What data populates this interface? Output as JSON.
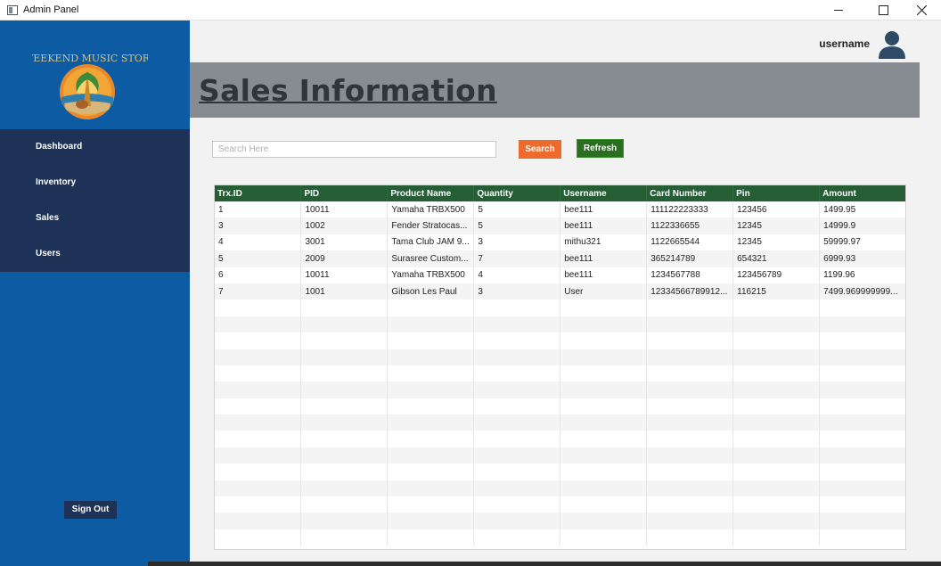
{
  "window": {
    "title": "Admin Panel"
  },
  "sidebar": {
    "logo_text": "WEEKEND MUSIC STORE",
    "items": [
      {
        "label": "Dashboard"
      },
      {
        "label": "Inventory"
      },
      {
        "label": "Sales"
      },
      {
        "label": "Users"
      }
    ],
    "signout_label": "Sign Out"
  },
  "header": {
    "username": "username"
  },
  "page": {
    "title": "Sales Information"
  },
  "search": {
    "placeholder": "Search Here",
    "search_label": "Search",
    "refresh_label": "Refresh"
  },
  "table": {
    "columns": [
      "Trx.ID",
      "PID",
      "Product Name",
      "Quantity",
      "Username",
      "Card Number",
      "Pin",
      "Amount"
    ],
    "rows": [
      [
        "1",
        "10011",
        "Yamaha TRBX500",
        "5",
        "bee111",
        "111122223333",
        "123456",
        "1499.95"
      ],
      [
        "3",
        "1002",
        "Fender Stratocas...",
        "5",
        "bee111",
        "1122336655",
        "12345",
        "14999.9"
      ],
      [
        "4",
        "3001",
        "Tama Club JAM 9...",
        "3",
        "mithu321",
        "1122665544",
        "12345",
        "59999.97"
      ],
      [
        "5",
        "2009",
        "Surasree Custom...",
        "7",
        "bee111",
        "365214789",
        "654321",
        "6999.93"
      ],
      [
        "6",
        "10011",
        "Yamaha TRBX500",
        "4",
        "bee111",
        "1234567788",
        "123456789",
        "1199.96"
      ],
      [
        "7",
        "1001",
        "Gibson Les Paul",
        "3",
        "User",
        "12334566789912...",
        "116215",
        "7499.969999999..."
      ]
    ]
  },
  "colors": {
    "sidebar": "#0d5ba3",
    "nav": "#1e3258",
    "banner": "#878c93",
    "table_header": "#255d35",
    "search_button": "#ef6a2d",
    "refresh_button": "#2a6e1f"
  }
}
